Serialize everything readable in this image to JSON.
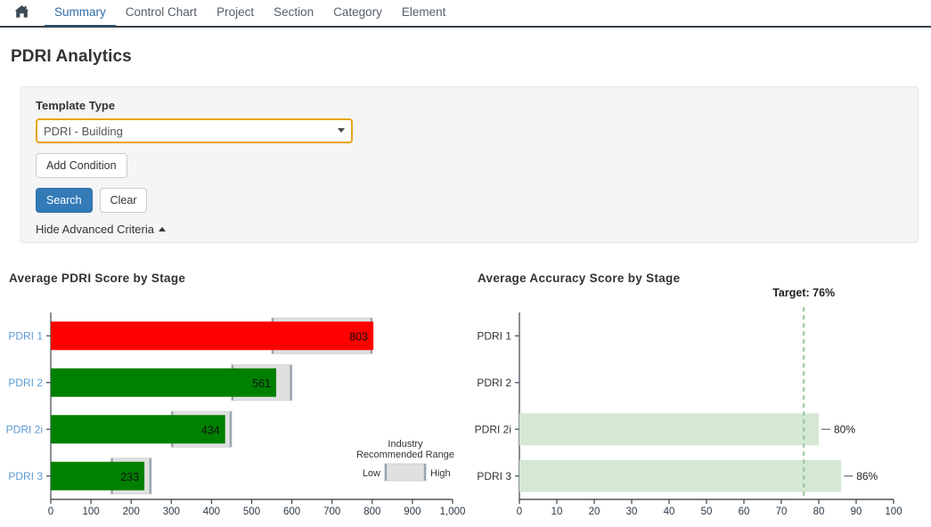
{
  "nav": {
    "home_icon": "home-icon",
    "items": [
      {
        "label": "Summary",
        "active": true
      },
      {
        "label": "Control Chart",
        "active": false
      },
      {
        "label": "Project",
        "active": false
      },
      {
        "label": "Section",
        "active": false
      },
      {
        "label": "Category",
        "active": false
      },
      {
        "label": "Element",
        "active": false
      }
    ]
  },
  "page": {
    "title": "PDRI Analytics"
  },
  "search_panel": {
    "template_type_label": "Template Type",
    "template_type_value": "PDRI - Building",
    "template_type_options": [
      "PDRI - Building"
    ],
    "add_condition_label": "Add Condition",
    "search_label": "Search",
    "clear_label": "Clear",
    "advanced_link_label": "Hide Advanced Criteria",
    "advanced_caret_icon": "chevron-up-icon"
  },
  "colors": {
    "accent_blue": "#337ab7",
    "link_blue": "#5b9bd5",
    "select_border_orange": "#e8a317",
    "bar_red": "#ff0000",
    "bar_green": "#008000",
    "range_gray": "#e0e0e0",
    "range_tick": "#9aa5b1",
    "accuracy_green": "#d4e8d4",
    "target_line_green": "#9cc49c"
  },
  "chart_data": [
    {
      "id": "average-pdri-score-by-stage",
      "type": "bar",
      "orientation": "horizontal",
      "title": "Average PDRI Score by Stage",
      "xlabel": "",
      "ylabel": "",
      "categories": [
        "PDRI 1",
        "PDRI 2",
        "PDRI 2i",
        "PDRI 3"
      ],
      "values": [
        803,
        561,
        434,
        233
      ],
      "value_labels": [
        "803",
        "561",
        "434",
        "233"
      ],
      "bar_colors": [
        "#ff0000",
        "#008000",
        "#008000",
        "#008000"
      ],
      "ranges": [
        {
          "low": 550,
          "high": 800
        },
        {
          "low": 450,
          "high": 600
        },
        {
          "low": 300,
          "high": 450
        },
        {
          "low": 150,
          "high": 250
        }
      ],
      "xlim": [
        0,
        1000
      ],
      "xticks": [
        0,
        100,
        200,
        300,
        400,
        500,
        600,
        700,
        800,
        900,
        1000
      ],
      "xtick_labels": [
        "0",
        "100",
        "200",
        "300",
        "400",
        "500",
        "600",
        "700",
        "800",
        "900",
        "1,000"
      ],
      "grid": false,
      "legend": {
        "title_line1": "Industry",
        "title_line2": "Recommended Range",
        "low_label": "Low",
        "high_label": "High",
        "position": "inside-bottom-right"
      }
    },
    {
      "id": "average-accuracy-score-by-stage",
      "type": "bar",
      "orientation": "horizontal",
      "title": "Average Accuracy Score by Stage",
      "xlabel": "",
      "ylabel": "",
      "categories": [
        "PDRI 1",
        "PDRI 2",
        "PDRI 2i",
        "PDRI 3"
      ],
      "values": [
        null,
        null,
        80,
        86
      ],
      "value_labels": [
        "",
        "",
        "80%",
        "86%"
      ],
      "bar_color": "#d4e8d4",
      "xlim": [
        0,
        100
      ],
      "xticks": [
        0,
        10,
        20,
        30,
        40,
        50,
        60,
        70,
        80,
        90,
        100
      ],
      "xtick_labels": [
        "0",
        "10",
        "20",
        "30",
        "40",
        "50",
        "60",
        "70",
        "80",
        "90",
        "100"
      ],
      "grid": false,
      "target": {
        "value": 76,
        "label": "Target: 76%",
        "style": "dashed"
      }
    }
  ]
}
